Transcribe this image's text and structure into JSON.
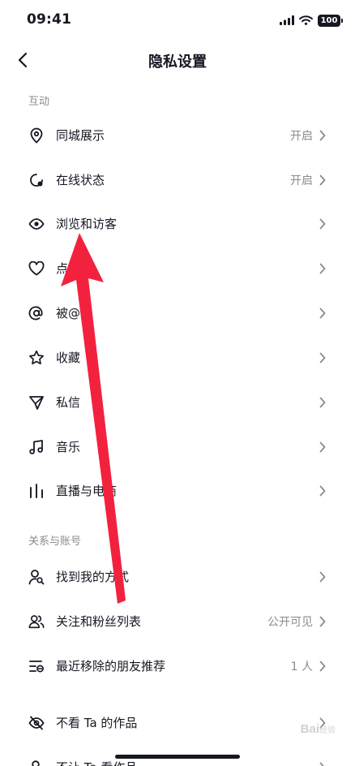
{
  "status_bar": {
    "time": "09:41",
    "battery": "100"
  },
  "header": {
    "title": "隐私设置"
  },
  "sections": [
    {
      "title": "互动"
    },
    {
      "title": "关系与账号"
    }
  ],
  "rows": [
    {
      "label": "同城展示",
      "value": "开启",
      "icon": "location-pin-icon"
    },
    {
      "label": "在线状态",
      "value": "开启",
      "icon": "online-status-icon"
    },
    {
      "label": "浏览和访客",
      "value": "",
      "icon": "eye-icon"
    },
    {
      "label": "点",
      "value": "",
      "icon": "heart-icon"
    },
    {
      "label": "被@",
      "value": "",
      "icon": "at-icon"
    },
    {
      "label": "收藏",
      "value": "",
      "icon": "star-icon"
    },
    {
      "label": "私信",
      "value": "",
      "icon": "send-icon"
    },
    {
      "label": "音乐",
      "value": "",
      "icon": "music-note-icon"
    },
    {
      "label": "直播与电商",
      "value": "",
      "icon": "bar-chart-icon"
    },
    {
      "label": "找到我的方式",
      "value": "",
      "icon": "find-user-icon"
    },
    {
      "label": "关注和粉丝列表",
      "value": "公开可见",
      "icon": "users-icon"
    },
    {
      "label": "最近移除的朋友推荐",
      "value": "1 人",
      "icon": "list-remove-icon"
    },
    {
      "label": "不看 Ta 的作品",
      "value": "",
      "icon": "eye-off-icon"
    },
    {
      "label": "不让 Ta 看作品",
      "value": "",
      "icon": "block-user-icon"
    }
  ],
  "annotation": {
    "color": "#f2223f"
  },
  "watermark": {
    "brand": "Bai",
    "suffix": "经验"
  }
}
